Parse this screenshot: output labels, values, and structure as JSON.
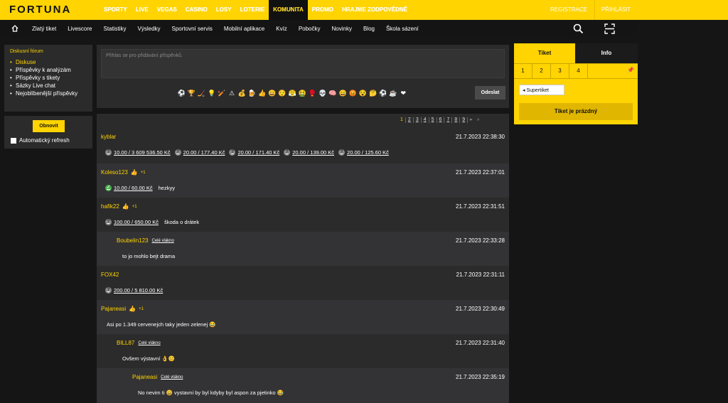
{
  "brand": {
    "logo": "FORTUNA"
  },
  "main_nav": [
    {
      "label": "SPORTY"
    },
    {
      "label": "LIVE"
    },
    {
      "label": "VEGAS"
    },
    {
      "label": "CASINO"
    },
    {
      "label": "LOSY"
    },
    {
      "label": "LOTERIE"
    },
    {
      "label": "KOMUNITA"
    },
    {
      "label": "PROMO"
    },
    {
      "label": "HRAJME ZODPOVĚDNĚ"
    }
  ],
  "active_main_nav": "KOMUNITA",
  "auth": {
    "register": "REGISTRACE",
    "login": "PŘIHLÁSIT"
  },
  "sub_nav": [
    {
      "label": "Zlatý tiket"
    },
    {
      "label": "Livescore"
    },
    {
      "label": "Statistiky"
    },
    {
      "label": "Výsledky"
    },
    {
      "label": "Sportovní servis"
    },
    {
      "label": "Mobilní aplikace"
    },
    {
      "label": "Kvíz"
    },
    {
      "label": "Pobočky"
    },
    {
      "label": "Novinky"
    },
    {
      "label": "Blog"
    },
    {
      "label": "Škola sázení"
    }
  ],
  "sidebar": {
    "title": "Diskusní fórum",
    "items": [
      {
        "label": "Diskuse"
      },
      {
        "label": "Příspěvky k analýzám"
      },
      {
        "label": "Příspěvky s tikety"
      },
      {
        "label": "Sázky Live chat"
      },
      {
        "label": "Nejoblíbenější příspěvky"
      }
    ],
    "refresh_label": "Obnovit",
    "auto_refresh_label": "Automatický refresh"
  },
  "compose": {
    "placeholder": "Přihlas se pro přidávání příspěvků.",
    "send_label": "Odeslat",
    "emojis": [
      "⚽",
      "🏆",
      "🏒",
      "💡",
      "🏏",
      "⚠",
      "💰",
      "🍺",
      "👍",
      "😀",
      "😌",
      "😤",
      "🤮",
      "🥊",
      "💀",
      "🧠",
      "😄",
      "😡",
      "😵",
      "🤔",
      "⚽",
      "☕",
      "❤"
    ]
  },
  "pager": {
    "pages": [
      "1",
      "2",
      "3",
      "4",
      "5",
      "6",
      "7",
      "8",
      "9"
    ],
    "current": "1",
    "next": "▸",
    "last": "»"
  },
  "posts": [
    {
      "author": "kyblar",
      "time": "21.7.2023 22:38:30",
      "tickets": [
        {
          "status": "?",
          "text": "10.00 / 3 609 536.50 Kč"
        },
        {
          "status": "?",
          "text": "20.00 / 177.40 Kč"
        },
        {
          "status": "?",
          "text": "20.00 / 171.40 Kč"
        },
        {
          "status": "?",
          "text": "20.00 / 139.00 Kč"
        },
        {
          "status": "?",
          "text": "20.00 / 125.60 Kč"
        }
      ],
      "text": ""
    },
    {
      "author": "Koleso123",
      "thumb": "👍",
      "plus": "+1",
      "time": "21.7.2023 22:37:01",
      "tickets": [
        {
          "status": "✓",
          "text": "10.00 / 60.00 Kč"
        }
      ],
      "text": "hezkyy"
    },
    {
      "author": "hafik22",
      "thumb": "👍",
      "plus": "+1",
      "time": "21.7.2023 22:31:51",
      "tickets": [
        {
          "status": "?",
          "text": "100.00 / 650.00 Kč"
        }
      ],
      "text": "škoda o drátek"
    },
    {
      "author": "Boubelin123",
      "thread": "Celé vlákno",
      "time": "21.7.2023 22:33:28",
      "tickets": [],
      "text": "to jo mohlo bejt drama"
    },
    {
      "author": "FOX42",
      "time": "21.7.2023 22:31:11",
      "tickets": [
        {
          "status": "?",
          "text": "200.00 / 5 810.00 Kč"
        }
      ],
      "text": ""
    },
    {
      "author": "Pajaneasi",
      "thumb": "👍",
      "plus": "+1",
      "time": "21.7.2023 22:30:49",
      "tickets": [],
      "text": "Asi po 1.349 cervenejch taky jeden zelenej 😂"
    },
    {
      "author": "BILL87",
      "thread": "Celé vlákno",
      "time": "21.7.2023 22:31:40",
      "tickets": [],
      "text": "Ovšem výstavní 👌😊"
    },
    {
      "author": "Pajaneasi",
      "thread": "Celé vlákno",
      "time": "21.7.2023 22:35:19",
      "tickets": [],
      "text": "No nevim ti 😄 vystavni by byl kdyby byl aspon za pjetinko 😂"
    }
  ],
  "ticket": {
    "tabs": [
      "Tiket",
      "Info"
    ],
    "numbers": [
      "1",
      "2",
      "3",
      "4"
    ],
    "super_label": "Supertiket",
    "empty_label": "Tiket je prázdný"
  }
}
